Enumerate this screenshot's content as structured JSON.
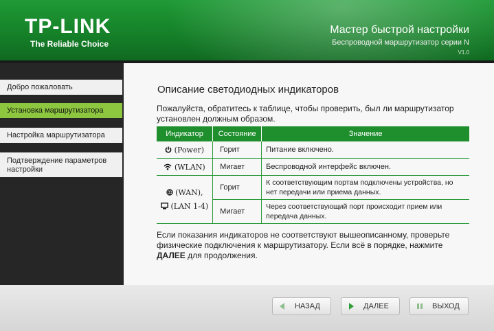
{
  "header": {
    "logo": "TP-LINK",
    "tagline": "The Reliable Choice",
    "title": "Мастер быстрой настройки",
    "subtitle": "Беспроводной маршрутизатор серии N",
    "version": "V1.0"
  },
  "sidebar": {
    "items": [
      {
        "label": "Добро пожаловать",
        "active": false
      },
      {
        "label": "Установка маршрутизатора",
        "active": true
      },
      {
        "label": "Настройка маршрутизатора",
        "active": false
      },
      {
        "label": "Подтверждение параметров настройки",
        "active": false
      }
    ]
  },
  "main": {
    "title": "Описание  светодиодных  индикаторов",
    "intro": "Пожалуйста, обратитесь к таблице, чтобы проверить, был ли маршрутизатор установлен должным образом.",
    "table": {
      "headers": [
        "Индикатор",
        "Состояние",
        "Значение"
      ],
      "rows": [
        {
          "indicator": "(Power)",
          "state": "Горит",
          "meaning": "Питание включено."
        },
        {
          "indicator": "(WLAN)",
          "state": "Мигает",
          "meaning": "Беспроводной интерфейс включен."
        },
        {
          "indicator_wan": "(WAN),",
          "indicator_lan": "(LAN 1-4)",
          "state_on": "Горит",
          "meaning_on": "К соответствующим портам подключены устройства, но нет передачи или приема данных.",
          "state_blink": "Мигает",
          "meaning_blink": "Через соответствующий порт происходит прием или передача данных."
        }
      ]
    },
    "outro_prefix": "Если показания индикаторов не соответствуют вышеописанному, проверьте физические подключения к маршрутизатору. Если всё в порядке, нажмите ",
    "outro_bold": "ДАЛЕЕ",
    "outro_suffix": " для продолжения."
  },
  "footer": {
    "back_label": "НАЗАД",
    "next_label": "ДАЛЕЕ",
    "exit_label": "ВЫХОД"
  },
  "colors": {
    "brand_green": "#1f8f2e",
    "active_item": "#8dc63f"
  }
}
